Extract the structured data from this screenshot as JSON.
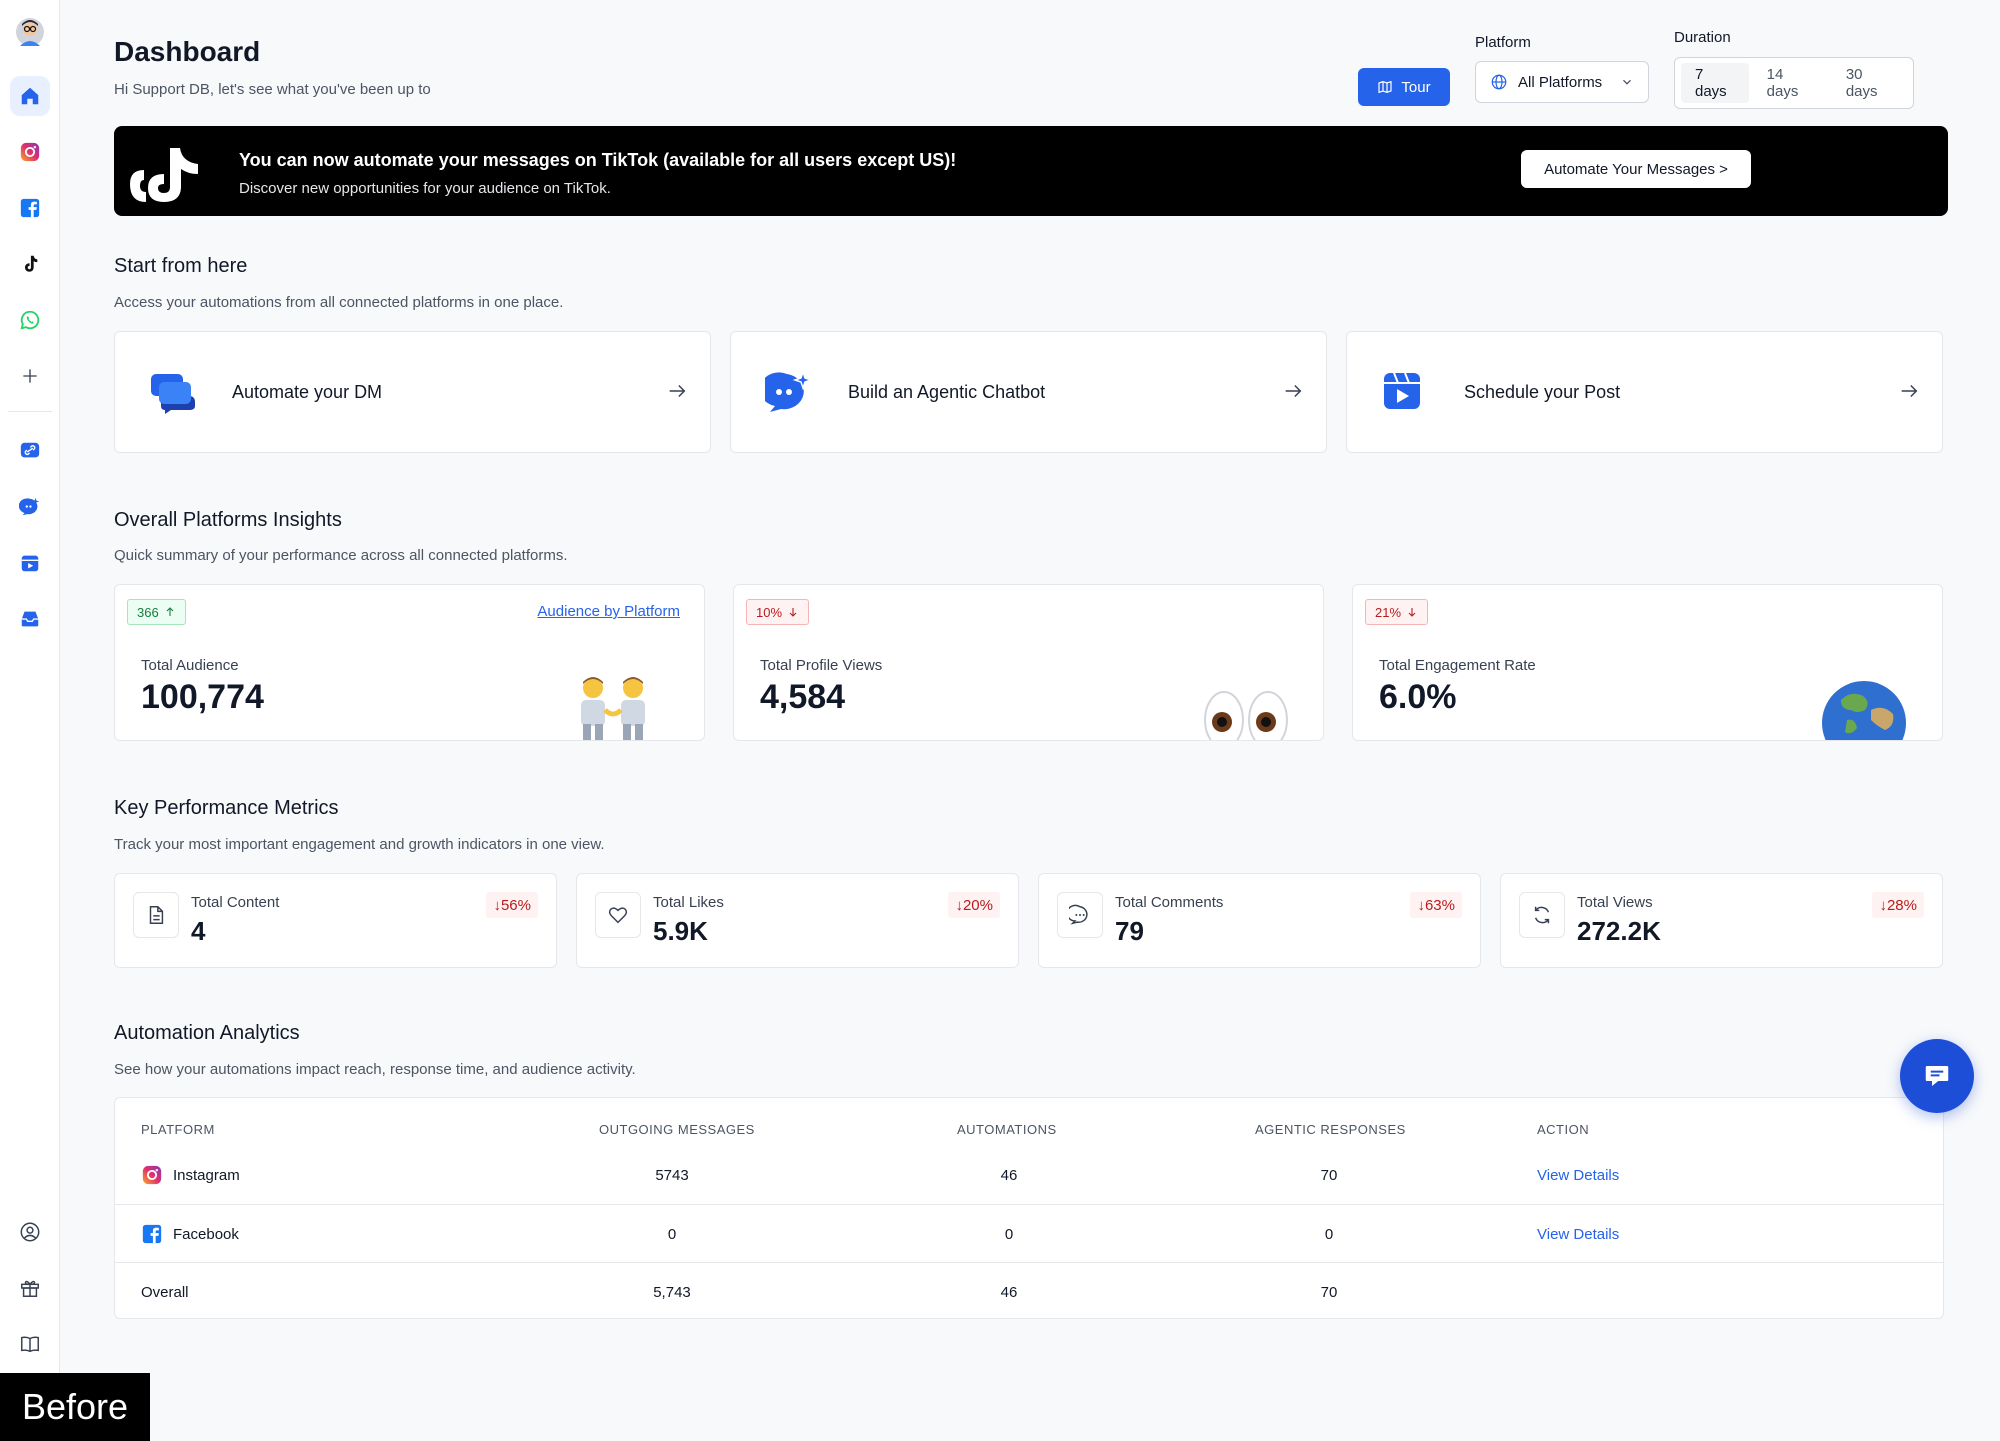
{
  "sidebar": {
    "items": [
      {
        "name": "home-icon",
        "active": true
      },
      {
        "name": "instagram-icon"
      },
      {
        "name": "facebook-icon"
      },
      {
        "name": "tiktok-icon"
      },
      {
        "name": "whatsapp-icon"
      },
      {
        "name": "plus-icon"
      },
      {
        "name": "link-icon"
      },
      {
        "name": "chatbot-icon"
      },
      {
        "name": "calendar-icon"
      },
      {
        "name": "inbox-icon"
      }
    ],
    "bottom": [
      {
        "name": "user-icon"
      },
      {
        "name": "gift-icon"
      },
      {
        "name": "book-icon"
      }
    ]
  },
  "header": {
    "title": "Dashboard",
    "subtitle": "Hi Support DB, let's see what you've been up to",
    "tour_label": "Tour",
    "platform_label": "Platform",
    "platform_value": "All Platforms",
    "duration_label": "Duration",
    "duration_options": [
      "7 days",
      "14 days",
      "30 days"
    ],
    "duration_selected": "7 days"
  },
  "banner": {
    "title": "You can now automate your messages on TikTok (available for all users except US)!",
    "subtitle": "Discover new opportunities for your audience on TikTok.",
    "button": "Automate Your Messages >"
  },
  "start": {
    "title": "Start from here",
    "subtitle": "Access your automations from all connected platforms in one place.",
    "cards": [
      {
        "label": "Automate your DM"
      },
      {
        "label": "Build an Agentic Chatbot"
      },
      {
        "label": "Schedule your Post"
      }
    ]
  },
  "insights": {
    "title": "Overall Platforms Insights",
    "subtitle": "Quick summary of your performance across all connected platforms.",
    "cards": [
      {
        "badge": "366",
        "direction": "up",
        "label": "Total Audience",
        "value": "100,774",
        "link": "Audience by Platform"
      },
      {
        "badge": "10%",
        "direction": "down",
        "label": "Total Profile Views",
        "value": "4,584"
      },
      {
        "badge": "21%",
        "direction": "down",
        "label": "Total Engagement Rate",
        "value": "6.0%"
      }
    ]
  },
  "kpi": {
    "title": "Key Performance Metrics",
    "subtitle": "Track your most important engagement and growth indicators in one view.",
    "cards": [
      {
        "label": "Total Content",
        "value": "4",
        "change": "↓56%"
      },
      {
        "label": "Total Likes",
        "value": "5.9K",
        "change": "↓20%"
      },
      {
        "label": "Total Comments",
        "value": "79",
        "change": "↓63%"
      },
      {
        "label": "Total Views",
        "value": "272.2K",
        "change": "↓28%"
      }
    ]
  },
  "analytics": {
    "title": "Automation Analytics",
    "subtitle": "See how your automations impact reach, response time, and audience activity.",
    "columns": [
      "PLATFORM",
      "OUTGOING MESSAGES",
      "AUTOMATIONS",
      "AGENTIC RESPONSES",
      "ACTION"
    ],
    "rows": [
      {
        "platform": "Instagram",
        "outgoing": "5743",
        "automations": "46",
        "agentic": "70",
        "action": "View Details"
      },
      {
        "platform": "Facebook",
        "outgoing": "0",
        "automations": "0",
        "agentic": "0",
        "action": "View Details"
      },
      {
        "platform": "Overall",
        "outgoing": "5,743",
        "automations": "46",
        "agentic": "70",
        "action": ""
      }
    ]
  },
  "overlay": {
    "before_label": "Before"
  },
  "colors": {
    "accent": "#2563eb",
    "banner_bg": "#000000",
    "positive": "#15803d",
    "negative": "#b91c1c"
  }
}
